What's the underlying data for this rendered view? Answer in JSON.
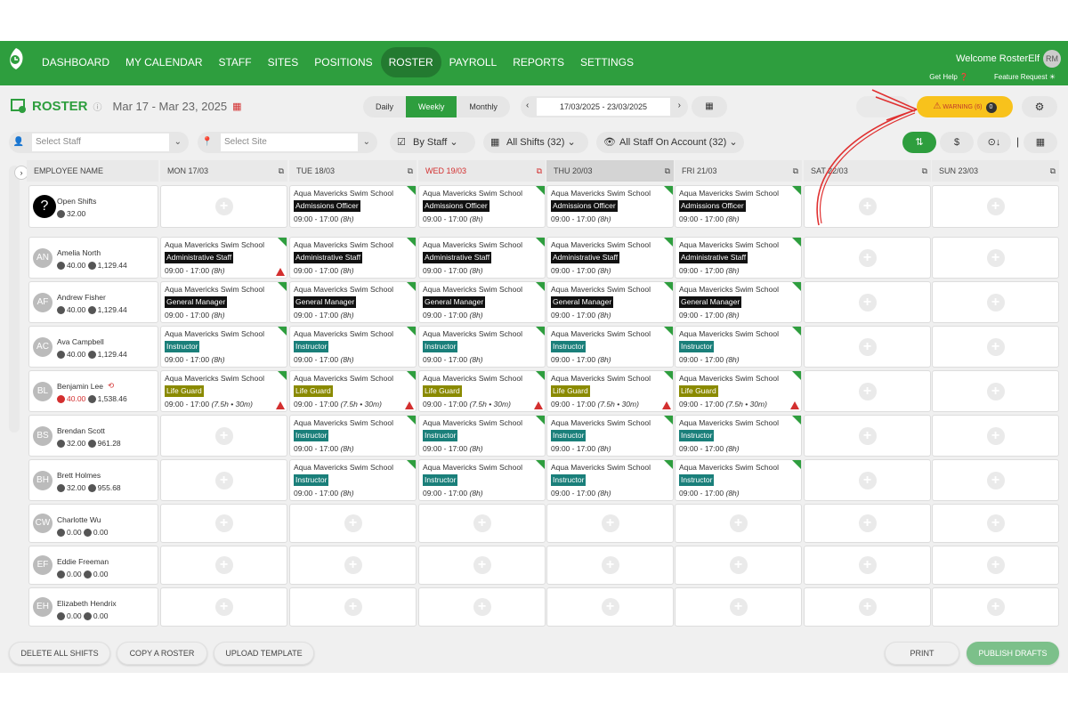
{
  "nav": {
    "items": [
      "DASHBOARD",
      "MY CALENDAR",
      "STAFF",
      "SITES",
      "POSITIONS",
      "ROSTER",
      "PAYROLL",
      "REPORTS",
      "SETTINGS"
    ],
    "active": "ROSTER",
    "welcome": "Welcome RosterElf",
    "avatar": "RM",
    "get_help": "Get Help",
    "feature_request": "Feature Request"
  },
  "header": {
    "title": "ROSTER",
    "date_range": "Mar 17 - Mar 23, 2025",
    "views": [
      "Daily",
      "Weekly",
      "Monthly"
    ],
    "active_view": "Weekly",
    "date_input": "17/03/2025 - 23/03/2025",
    "warning": "WARNING (6)",
    "warning_count": "0"
  },
  "filters": {
    "staff_placeholder": "Select Staff",
    "site_placeholder": "Select Site",
    "by_staff": "By Staff",
    "all_shifts": "All Shifts (32)",
    "all_staff": "All Staff On Account (32)",
    "icons": [
      "sort-az-icon",
      "dollar-icon",
      "clock-sort-icon",
      "calendar-icon"
    ]
  },
  "grid": {
    "employee_header": "EMPLOYEE NAME",
    "days": [
      "MON 17/03",
      "TUE 18/03",
      "WED 19/03",
      "THU 20/03",
      "FRI 21/03",
      "SAT 22/03",
      "SUN 23/03"
    ],
    "today_index": 2,
    "selected_index": 3
  },
  "rows": [
    {
      "initials": "",
      "name": "Open Shifts",
      "hours": "32.00",
      "pay": "",
      "shift": {
        "site": "Aqua Mavericks Swim School",
        "role": "Admissions Officer",
        "role_color": "#111111",
        "time": "09:00 - 17:00",
        "dur": "(8h)"
      },
      "days": [
        0,
        1,
        1,
        1,
        1,
        0,
        0
      ],
      "alerts": []
    },
    {
      "initials": "AN",
      "name": "Amelia North",
      "hours": "40.00",
      "pay": "1,129.44",
      "shift": {
        "site": "Aqua Mavericks Swim School",
        "role": "Administrative Staff",
        "role_color": "#111111",
        "time": "09:00 - 17:00",
        "dur": "(8h)"
      },
      "days": [
        1,
        1,
        1,
        1,
        1,
        0,
        0
      ],
      "alerts": [
        0
      ]
    },
    {
      "initials": "AF",
      "name": "Andrew Fisher",
      "hours": "40.00",
      "pay": "1,129.44",
      "shift": {
        "site": "Aqua Mavericks Swim School",
        "role": "General Manager",
        "role_color": "#111111",
        "time": "09:00 - 17:00",
        "dur": "(8h)"
      },
      "days": [
        1,
        1,
        1,
        1,
        1,
        0,
        0
      ],
      "alerts": []
    },
    {
      "initials": "AC",
      "name": "Ava Campbell",
      "hours": "40.00",
      "pay": "1,129.44",
      "shift": {
        "site": "Aqua Mavericks Swim School",
        "role": "Instructor",
        "role_color": "#1a7f7a",
        "time": "09:00 - 17:00",
        "dur": "(8h)"
      },
      "days": [
        1,
        1,
        1,
        1,
        1,
        0,
        0
      ],
      "alerts": []
    },
    {
      "initials": "BL",
      "name": "Benjamin Lee",
      "hours": "40.00",
      "pay": "1,538.46",
      "shift": {
        "site": "Aqua Mavericks Swim School",
        "role": "Life Guard",
        "role_color": "#8a8a00",
        "time": "09:00 - 17:00",
        "dur": "(7.5h • 30m)"
      },
      "days": [
        1,
        1,
        1,
        1,
        1,
        0,
        0
      ],
      "alerts": [
        0,
        1,
        2,
        3,
        4
      ],
      "hours_red": true
    },
    {
      "initials": "BS",
      "name": "Brendan Scott",
      "hours": "32.00",
      "pay": "961.28",
      "shift": {
        "site": "Aqua Mavericks Swim School",
        "role": "Instructor",
        "role_color": "#1a7f7a",
        "time": "09:00 - 17:00",
        "dur": "(8h)"
      },
      "days": [
        0,
        1,
        1,
        1,
        1,
        0,
        0
      ],
      "alerts": []
    },
    {
      "initials": "BH",
      "name": "Brett Holmes",
      "hours": "32.00",
      "pay": "955.68",
      "shift": {
        "site": "Aqua Mavericks Swim School",
        "role": "Instructor",
        "role_color": "#1a7f7a",
        "time": "09:00 - 17:00",
        "dur": "(8h)"
      },
      "days": [
        0,
        1,
        1,
        1,
        1,
        0,
        0
      ],
      "alerts": []
    },
    {
      "initials": "CW",
      "name": "Charlotte Wu",
      "hours": "0.00",
      "pay": "0.00",
      "days": [
        0,
        0,
        0,
        0,
        0,
        0,
        0
      ],
      "alerts": []
    },
    {
      "initials": "EF",
      "name": "Eddie Freeman",
      "hours": "0.00",
      "pay": "0.00",
      "days": [
        0,
        0,
        0,
        0,
        0,
        0,
        0
      ],
      "alerts": []
    },
    {
      "initials": "EH",
      "name": "Elizabeth Hendrix",
      "hours": "0.00",
      "pay": "0.00",
      "days": [
        0,
        0,
        0,
        0,
        0,
        0,
        0
      ],
      "alerts": []
    }
  ],
  "bottom": {
    "delete": "DELETE ALL SHIFTS",
    "copy": "COPY A ROSTER",
    "upload": "UPLOAD TEMPLATE",
    "print": "PRINT",
    "publish": "PUBLISH DRAFTS"
  },
  "colors": {
    "brand": "#2e9e3e",
    "warning": "#f8c21c",
    "alert": "#d32f2f"
  }
}
